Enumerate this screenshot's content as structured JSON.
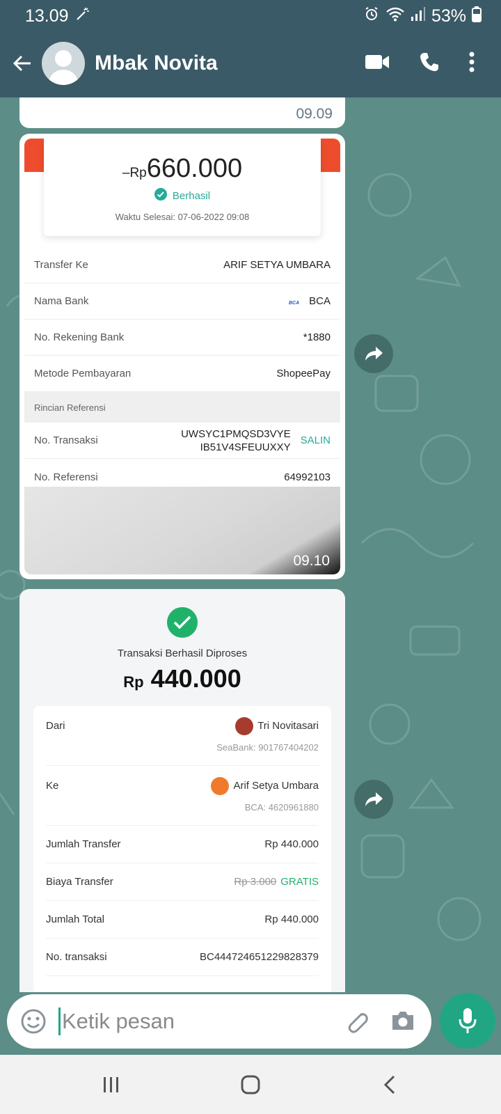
{
  "status_bar": {
    "time": "13.09",
    "battery": "53%"
  },
  "header": {
    "contact_name": "Mbak Novita"
  },
  "messages": {
    "first_time": "09.09",
    "receipt_shopee": {
      "currency": "–Rp",
      "amount": "660.000",
      "status": "Berhasil",
      "completed_at": "Waktu Selesai: 07-06-2022 09:08",
      "rows": [
        {
          "label": "Transfer Ke",
          "value": "ARIF SETYA UMBARA"
        },
        {
          "label": "Nama Bank",
          "value": "BCA",
          "logo": "BCA"
        },
        {
          "label": "No. Rekening Bank",
          "value": "*1880"
        },
        {
          "label": "Metode Pembayaran",
          "value": "ShopeePay"
        }
      ],
      "ref_header": "Rincian Referensi",
      "transaction_label": "No. Transaksi",
      "transaction_line1": "UWSYC1PMQSD3VYE",
      "transaction_line2": "IB51V4SFEUUXXY",
      "copy_label": "SALIN",
      "reference_label": "No. Referensi",
      "reference_value": "64992103",
      "time": "09.10"
    },
    "receipt_seabank": {
      "title": "Transaksi Berhasil Diproses",
      "currency": "Rp",
      "amount": "440.000",
      "from_label": "Dari",
      "from_name": "Tri Novitasari",
      "from_account": "SeaBank: 901767404202",
      "to_label": "Ke",
      "to_name": "Arif Setya Umbara",
      "to_account": "BCA: 4620961880",
      "amount_label": "Jumlah Transfer",
      "amount_value": "Rp 440.000",
      "fee_label": "Biaya Transfer",
      "fee_original": "Rp 3.000",
      "fee_value": "GRATIS",
      "total_label": "Jumlah Total",
      "total_value": "Rp 440.000",
      "txn_label": "No. transaksi",
      "txn_value": "BC444724651229828379"
    }
  },
  "composer": {
    "placeholder": "Ketik pesan"
  },
  "colors": {
    "header": "#3b5a67",
    "accent": "#20a683",
    "shopee": "#ee4d2d",
    "success": "#26aa99"
  }
}
